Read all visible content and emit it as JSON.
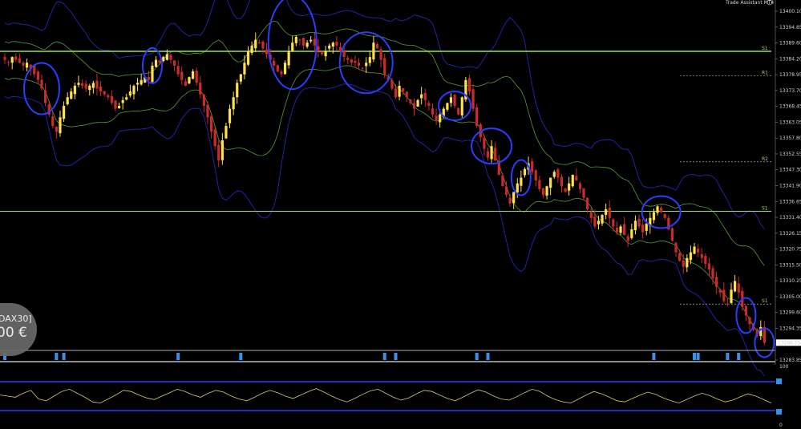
{
  "header": {
    "indicator_name": "Trade Assistant MT4"
  },
  "badge": {
    "symbol": "DAX30]",
    "price": "00 €"
  },
  "colors": {
    "background": "#000000",
    "bull": "#ffe24a",
    "bear": "#cc2b2b",
    "bands_outer": "#1f24a6",
    "bands_inner": "#5c9a34",
    "levels": "#9be04a",
    "circles": "#2b3dff",
    "markers": "#3a8fe8",
    "oscillator": "#d9c77a"
  },
  "chart_data": [
    {
      "type": "candlestick",
      "title": "",
      "xlabel": "",
      "ylabel": "",
      "ylim": [
        13283.85,
        13402.5
      ],
      "y_ticks": [
        "13400.10",
        "13394.85",
        "13389.60",
        "13384.20",
        "13378.95",
        "13373.70",
        "13368.45",
        "13363.05",
        "13357.80",
        "13352.55",
        "13347.30",
        "13341.90",
        "13336.65",
        "13331.40",
        "13326.15",
        "13320.75",
        "13315.50",
        "13310.25",
        "13305.00",
        "13299.60",
        "13294.35",
        "13289.10",
        "13283.85"
      ],
      "current_price": "13286.55",
      "levels": [
        {
          "label": "S1",
          "value": 13388.0,
          "style": "solid"
        },
        {
          "label": "S1",
          "value": 13332.3,
          "style": "solid"
        },
        {
          "label": "R1",
          "value": 13379.4,
          "style": "dotted"
        },
        {
          "label": "R2",
          "value": 13349.5,
          "style": "dotted"
        },
        {
          "label": "S1",
          "value": 13300.0,
          "style": "dotted"
        }
      ],
      "ohlc_close_path": [
        13385,
        13384,
        13386,
        13385,
        13384,
        13383,
        13384,
        13382,
        13380,
        13378,
        13375,
        13370,
        13366,
        13362,
        13360,
        13365,
        13369,
        13372,
        13374,
        13376,
        13377,
        13376,
        13375,
        13376,
        13377,
        13375,
        13374,
        13373,
        13372,
        13370,
        13368,
        13369,
        13371,
        13372,
        13374,
        13376,
        13377,
        13378,
        13379,
        13378,
        13383,
        13385,
        13384,
        13386,
        13387,
        13385,
        13383,
        13380,
        13378,
        13376,
        13379,
        13381,
        13377,
        13373,
        13369,
        13365,
        13360,
        13355,
        13350,
        13357,
        13362,
        13368,
        13372,
        13377,
        13380,
        13384,
        13388,
        13390,
        13392,
        13391,
        13389,
        13387,
        13385,
        13383,
        13381,
        13380,
        13384,
        13388,
        13391,
        13393,
        13392,
        13390,
        13391,
        13392,
        13390,
        13388,
        13387,
        13388,
        13390,
        13391,
        13390,
        13388,
        13386,
        13385,
        13384,
        13384,
        13383,
        13382,
        13384,
        13386,
        13391,
        13389,
        13385,
        13380,
        13378,
        13375,
        13372,
        13376,
        13374,
        13372,
        13370,
        13368,
        13371,
        13373,
        13371,
        13369,
        13366,
        13364,
        13366,
        13368,
        13370,
        13372,
        13369,
        13366,
        13372,
        13378,
        13374,
        13368,
        13362,
        13358,
        13354,
        13351,
        13355,
        13350,
        13345,
        13341,
        13338,
        13335,
        13339,
        13342,
        13344,
        13347,
        13349,
        13346,
        13343,
        13340,
        13338,
        13341,
        13344,
        13346,
        13344,
        13341,
        13339,
        13342,
        13345,
        13343,
        13340,
        13337,
        13333,
        13330,
        13327,
        13329,
        13331,
        13333,
        13330,
        13327,
        13325,
        13327,
        13324,
        13322,
        13326,
        13329,
        13327,
        13325,
        13328,
        13330,
        13332,
        13334,
        13332,
        13330,
        13326,
        13322,
        13318,
        13315,
        13313,
        13316,
        13318,
        13320,
        13318,
        13316,
        13314,
        13312,
        13309,
        13306,
        13304,
        13301,
        13300,
        13305,
        13308,
        13304,
        13299,
        13296,
        13293,
        13291,
        13289,
        13292,
        13286.5
      ],
      "signal_circles": 11,
      "signal_markers": 14
    },
    {
      "type": "line",
      "title": "",
      "ylim": [
        0,
        100
      ],
      "y_ticks": [
        "100",
        "0"
      ],
      "series": [
        {
          "values": [
            52,
            50,
            48,
            55,
            60,
            45,
            42,
            50,
            58,
            62,
            55,
            48,
            40,
            38,
            45,
            52,
            60,
            58,
            52,
            47,
            44,
            50,
            56,
            62,
            58,
            52,
            48,
            55,
            60,
            57,
            50,
            45,
            42,
            48,
            55,
            60,
            56,
            50,
            46,
            52,
            58,
            63,
            57,
            50,
            44,
            40,
            46,
            53,
            59,
            62,
            55,
            48,
            43,
            47,
            54,
            60,
            58,
            52,
            46,
            42,
            48,
            55,
            61,
            57,
            50,
            45,
            43,
            49,
            56,
            62,
            58,
            50,
            44,
            40,
            38,
            45,
            52,
            58,
            54,
            48,
            42,
            40,
            46,
            52,
            57,
            53,
            47,
            42,
            38,
            44,
            50,
            55,
            51,
            45,
            40,
            43,
            49,
            54,
            50,
            44,
            38
          ]
        }
      ]
    }
  ]
}
